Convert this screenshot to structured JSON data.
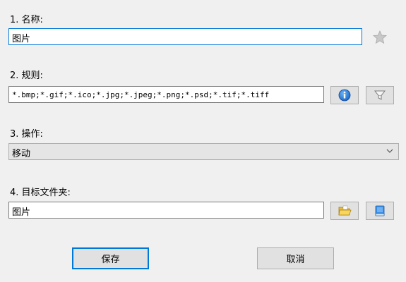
{
  "section1": {
    "label": "1. 名称:",
    "value": "图片",
    "star_icon": "star-icon"
  },
  "section2": {
    "label": "2. 规则:",
    "value": "*.bmp;*.gif;*.ico;*.jpg;*.jpeg;*.png;*.psd;*.tif;*.tiff",
    "info_icon": "info-icon",
    "filter_icon": "filter-icon"
  },
  "section3": {
    "label": "3. 操作:",
    "selected": "移动"
  },
  "section4": {
    "label": "4. 目标文件夹:",
    "value": "图片",
    "folder_icon": "folder-icon",
    "book_icon": "book-icon"
  },
  "buttons": {
    "save": "保存",
    "cancel": "取消"
  },
  "colors": {
    "focus_border": "#0078d7",
    "background": "#f0f0f0",
    "button_bg": "#e1e1e1"
  }
}
